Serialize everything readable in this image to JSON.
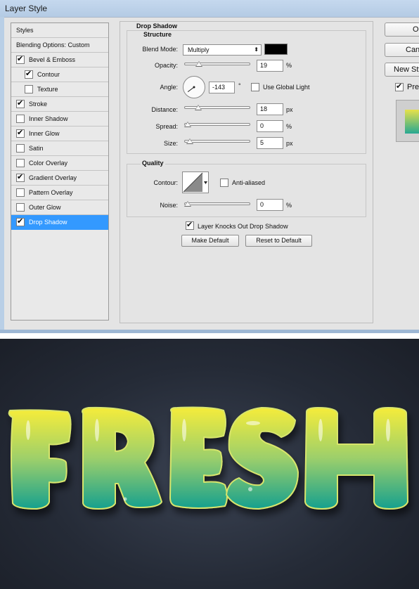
{
  "dialog": {
    "title": "Layer Style",
    "buttons": {
      "ok": "OK",
      "cancel": "Cancel",
      "new_style": "New Style...",
      "preview": "Preview"
    },
    "styles": [
      {
        "label": "Styles",
        "type": "header"
      },
      {
        "label": "Blending Options: Custom",
        "type": "header"
      },
      {
        "label": "Bevel & Emboss",
        "checked": true
      },
      {
        "label": "Contour",
        "checked": true,
        "sub": true
      },
      {
        "label": "Texture",
        "checked": false,
        "sub": true
      },
      {
        "label": "Stroke",
        "checked": true
      },
      {
        "label": "Inner Shadow",
        "checked": false
      },
      {
        "label": "Inner Glow",
        "checked": true
      },
      {
        "label": "Satin",
        "checked": false
      },
      {
        "label": "Color Overlay",
        "checked": false
      },
      {
        "label": "Gradient Overlay",
        "checked": true
      },
      {
        "label": "Pattern Overlay",
        "checked": false
      },
      {
        "label": "Outer Glow",
        "checked": false
      },
      {
        "label": "Drop Shadow",
        "checked": true,
        "selected": true
      }
    ],
    "drop_shadow": {
      "section_title": "Drop Shadow",
      "structure_title": "Structure",
      "blend_mode_label": "Blend Mode:",
      "blend_mode_value": "Multiply",
      "shadow_color": "#000000",
      "opacity_label": "Opacity:",
      "opacity_value": "19",
      "opacity_unit": "%",
      "opacity_level": 0.19,
      "angle_label": "Angle:",
      "angle_value": "-143",
      "angle_unit": "°",
      "use_global_light_label": "Use Global Light",
      "use_global_light": false,
      "distance_label": "Distance:",
      "distance_value": "18",
      "distance_unit": "px",
      "distance_level": 0.18,
      "spread_label": "Spread:",
      "spread_value": "0",
      "spread_unit": "%",
      "spread_level": 0.0,
      "size_label": "Size:",
      "size_value": "5",
      "size_unit": "px",
      "size_level": 0.04,
      "quality_title": "Quality",
      "contour_label": "Contour:",
      "anti_aliased_label": "Anti-aliased",
      "anti_aliased": false,
      "noise_label": "Noise:",
      "noise_value": "0",
      "noise_unit": "%",
      "noise_level": 0.0,
      "layer_knocks_out_label": "Layer Knocks Out Drop Shadow",
      "layer_knocks_out": true,
      "make_default_label": "Make Default",
      "reset_default_label": "Reset to Default"
    }
  },
  "artwork": {
    "text": "FRESH",
    "gradient_top": "#f2e93a",
    "gradient_bottom": "#19a48f",
    "background": "#252b37"
  }
}
